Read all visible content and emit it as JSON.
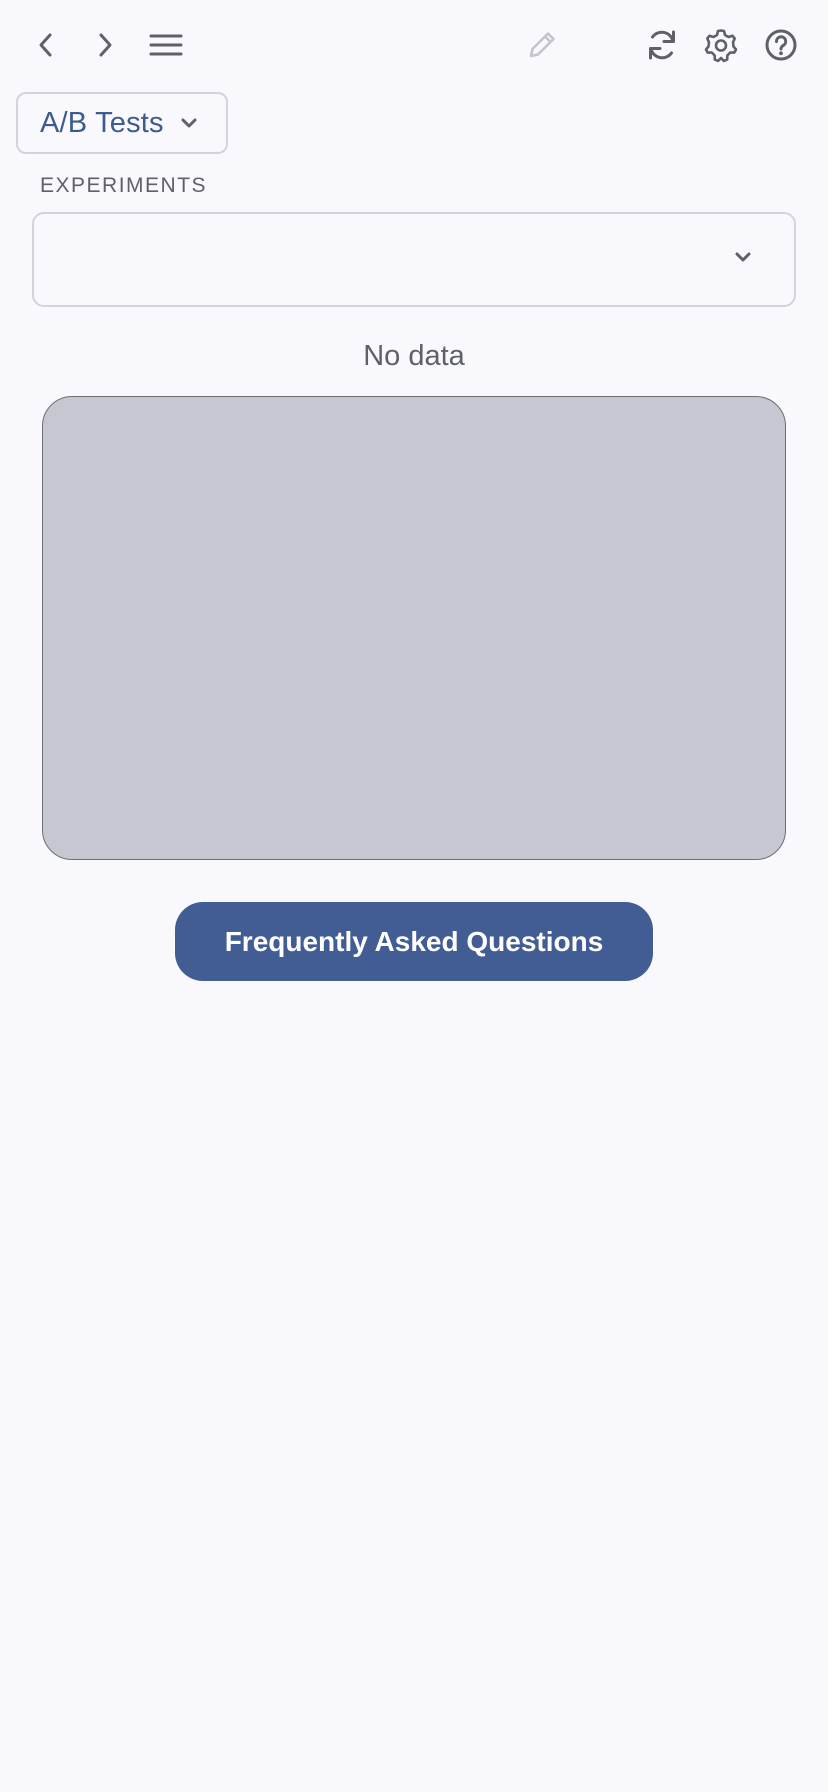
{
  "toolbar": {
    "icons": {
      "back": "chevron-left-icon",
      "forward": "chevron-right-icon",
      "menu": "hamburger-menu-icon",
      "edit": "pencil-icon",
      "refresh": "refresh-icon",
      "settings": "gear-icon",
      "help": "question-circle-icon"
    },
    "edit_disabled": true
  },
  "app_select": {
    "selected": "A/B Tests"
  },
  "experiments": {
    "label": "EXPERIMENTS",
    "selected": ""
  },
  "status": {
    "message": "No data"
  },
  "faq_button": {
    "label": "Frequently Asked Questions"
  },
  "colors": {
    "background": "#f8f8fd",
    "accent": "#425d93",
    "accent_text": "#3e5a8e",
    "panel": "#c5c8d0",
    "muted_text": "#5f6168",
    "disabled_icon": "#c4c5ca"
  }
}
